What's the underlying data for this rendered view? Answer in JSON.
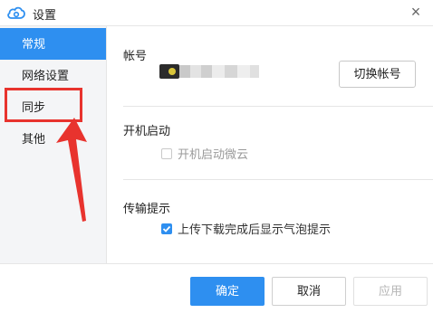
{
  "window": {
    "title": "设置",
    "close_glyph": "×",
    "app_icon": "cloud-icon"
  },
  "sidebar": {
    "items": [
      {
        "label": "常规",
        "active": true
      },
      {
        "label": "网络设置",
        "active": false
      },
      {
        "label": "同步",
        "active": false
      },
      {
        "label": "其他",
        "active": false
      }
    ]
  },
  "account": {
    "label": "帐号",
    "switch_button": "切换帐号"
  },
  "startup": {
    "label": "开机启动",
    "checkbox_label": "开机启动微云",
    "checked": false
  },
  "transfer": {
    "label": "传输提示",
    "checkbox_label": "上传下载完成后显示气泡提示",
    "checked": true
  },
  "footer": {
    "ok": "确定",
    "cancel": "取消",
    "apply": "应用"
  },
  "colors": {
    "accent": "#2e8ff0",
    "annotation": "#e8332e"
  }
}
